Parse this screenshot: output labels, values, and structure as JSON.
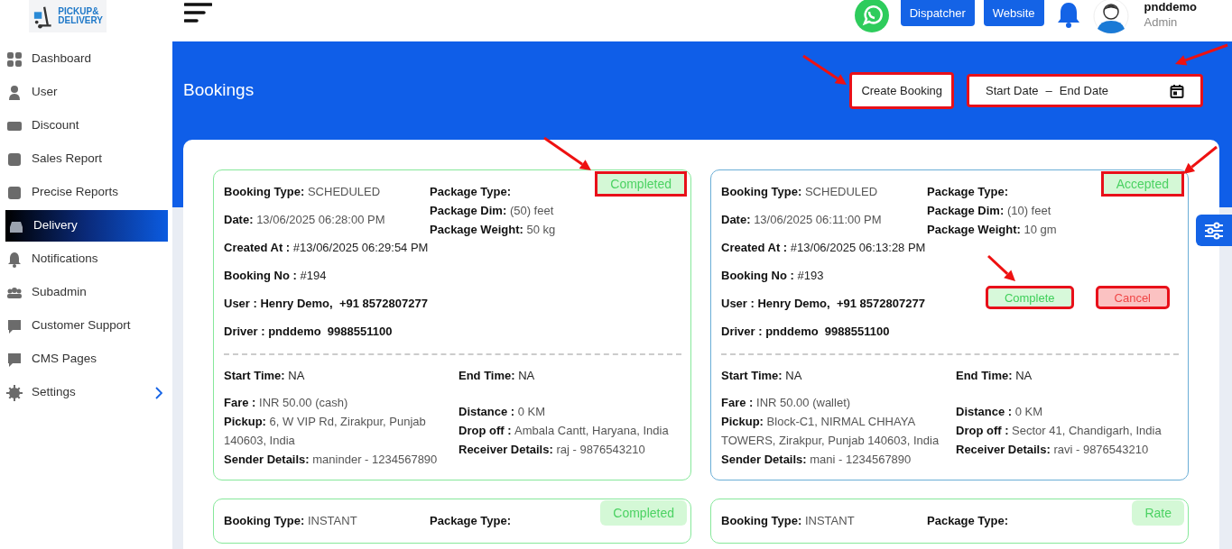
{
  "logo": {
    "lines": [
      "PICKUP&",
      "DELIVERY"
    ]
  },
  "sidebar": {
    "items": [
      {
        "label": "Dashboard",
        "selected": false,
        "submenu": false
      },
      {
        "label": "User",
        "selected": false,
        "submenu": false
      },
      {
        "label": "Discount",
        "selected": false,
        "submenu": false
      },
      {
        "label": "Sales Report",
        "selected": false,
        "submenu": false
      },
      {
        "label": "Precise Reports",
        "selected": false,
        "submenu": false
      },
      {
        "label": "Delivery",
        "selected": true,
        "submenu": false
      },
      {
        "label": "Notifications",
        "selected": false,
        "submenu": false
      },
      {
        "label": "Subadmin",
        "selected": false,
        "submenu": false
      },
      {
        "label": "Customer Support",
        "selected": false,
        "submenu": false
      },
      {
        "label": "CMS Pages",
        "selected": false,
        "submenu": false
      },
      {
        "label": "Settings",
        "selected": false,
        "submenu": true
      }
    ]
  },
  "header": {
    "buttons": [
      "Dispatcher",
      "Website"
    ],
    "user": {
      "name": "pnddemo",
      "role": "Admin"
    }
  },
  "page": {
    "title": "Bookings",
    "create_button": {
      "label": "Create Booking",
      "highlighted": true
    },
    "date_range": {
      "start_placeholder": "Start Date",
      "separator": "–",
      "end_placeholder": "End Date",
      "highlighted": true
    }
  },
  "bookings": [
    {
      "status": {
        "label": "Completed",
        "kind": "completed",
        "highlighted": true
      },
      "top_left": [
        {
          "label": "Booking Type:",
          "value": "SCHEDULED",
          "kind": "muted"
        },
        {
          "label": "Date:",
          "value": "13/06/2025 06:28:00 PM",
          "kind": "muted"
        },
        {
          "label": "Created At :",
          "value": "#13/06/2025 06:29:54 PM",
          "kind": "plain"
        },
        {
          "label": "Booking No :",
          "value": "#194",
          "kind": "plain"
        },
        {
          "label": "User :",
          "value": "Henry Demo,  +91 8572807277",
          "kind": "strong"
        },
        {
          "label": "Driver :",
          "value": "pnddemo  9988551100",
          "kind": "strong"
        }
      ],
      "top_right": [
        {
          "label": "Package Type:"
        },
        {
          "label": "Package Dim:",
          "value": "(50) feet"
        },
        {
          "label": "Package Weight:",
          "value": "50 kg"
        }
      ],
      "times": [
        {
          "label": "Start Time:",
          "value": "NA"
        },
        {
          "label": "End Time:",
          "value": "NA"
        }
      ],
      "bottom_left": [
        {
          "label": "Fare :",
          "value": "INR 50.00 (cash)"
        },
        {
          "label": "Pickup:",
          "value": "6, W VIP Rd, Zirakpur, Punjab 140603, India"
        },
        {
          "label": "Sender Details:",
          "value": "maninder - 1234567890"
        }
      ],
      "bottom_right": [
        {
          "label": "Distance :",
          "value": "0 KM"
        },
        {
          "label": "Drop off :",
          "value": "Ambala Cantt, Haryana, India"
        },
        {
          "label": "Receiver Details:",
          "value": "raj - 9876543210"
        }
      ]
    },
    {
      "status": {
        "label": "Accepted",
        "kind": "accepted",
        "highlighted": true
      },
      "top_left": [
        {
          "label": "Booking Type:",
          "value": "SCHEDULED",
          "kind": "muted"
        },
        {
          "label": "Date:",
          "value": "13/06/2025 06:11:00 PM",
          "kind": "muted"
        },
        {
          "label": "Created At :",
          "value": "#13/06/2025 06:13:28 PM",
          "kind": "plain"
        },
        {
          "label": "Booking No :",
          "value": "#193",
          "kind": "plain"
        },
        {
          "label": "User :",
          "value": "Henry Demo,  +91 8572807277",
          "kind": "strong"
        },
        {
          "label": "Driver :",
          "value": "pnddemo  9988551100",
          "kind": "strong"
        }
      ],
      "top_right": [
        {
          "label": "Package Type:"
        },
        {
          "label": "Package Dim:",
          "value": "(10) feet"
        },
        {
          "label": "Package Weight:",
          "value": "10 gm"
        }
      ],
      "actions": [
        {
          "label": "Complete",
          "kind": "complete",
          "highlighted": true
        },
        {
          "label": "Cancel",
          "kind": "cancel",
          "highlighted": true
        }
      ],
      "times": [
        {
          "label": "Start Time:",
          "value": "NA"
        },
        {
          "label": "End Time:",
          "value": "NA"
        }
      ],
      "bottom_left": [
        {
          "label": "Fare :",
          "value": "INR 50.00 (wallet)"
        },
        {
          "label": "Pickup:",
          "value": "Block-C1, NIRMAL CHHAYA TOWERS, Zirakpur, Punjab 140603, India"
        },
        {
          "label": "Sender Details:",
          "value": "mani - 1234567890"
        }
      ],
      "bottom_right": [
        {
          "label": "Distance :",
          "value": "0 KM"
        },
        {
          "label": "Drop off :",
          "value": "Sector 41, Chandigarh, India"
        },
        {
          "label": "Receiver Details:",
          "value": "ravi - 9876543210"
        }
      ]
    },
    {
      "status": {
        "label": "Completed",
        "kind": "completed",
        "highlighted": false
      },
      "top_left": [
        {
          "label": "Booking Type:",
          "value": "INSTANT",
          "kind": "muted"
        }
      ],
      "top_right": [
        {
          "label": "Package Type:"
        }
      ]
    },
    {
      "status": {
        "label": "Rate",
        "kind": "rate",
        "highlighted": false
      },
      "top_left": [
        {
          "label": "Booking Type:",
          "value": "INSTANT",
          "kind": "muted"
        }
      ],
      "top_right": [
        {
          "label": "Package Type:"
        }
      ]
    }
  ]
}
